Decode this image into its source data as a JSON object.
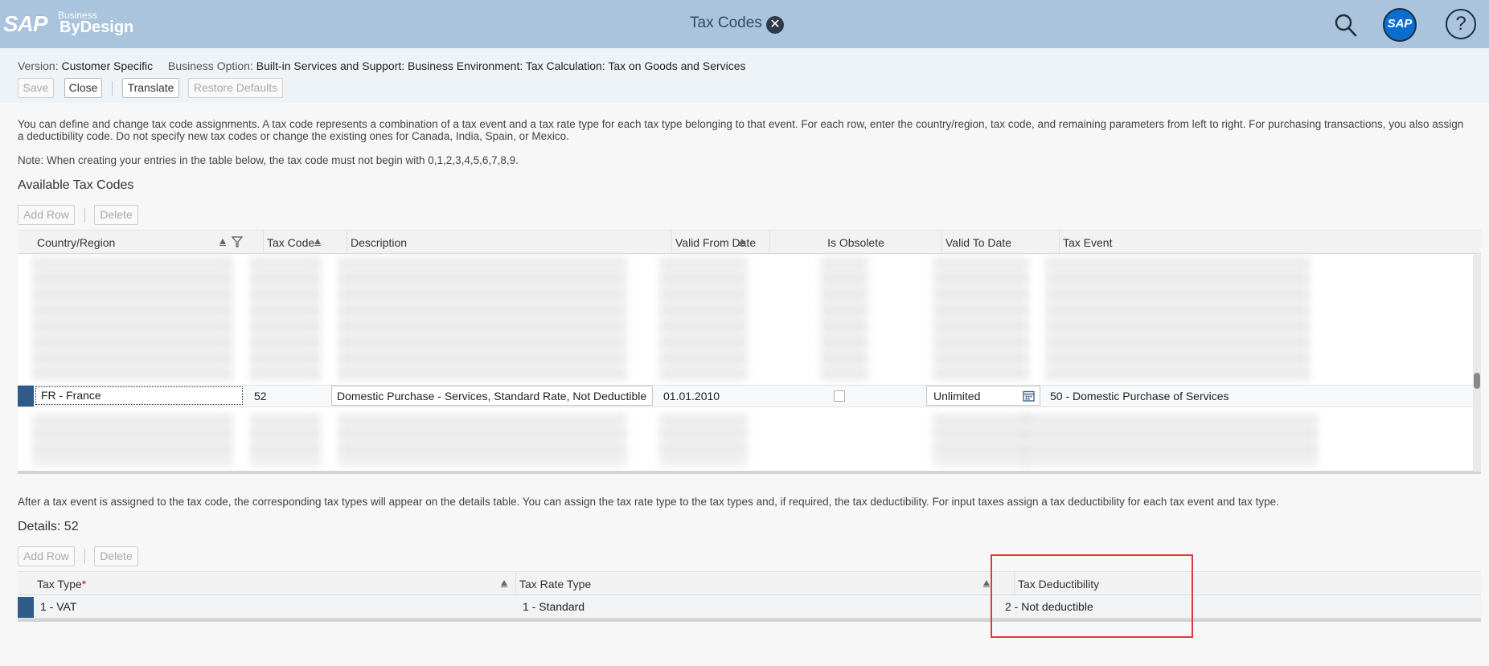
{
  "shell": {
    "logo_sap": "SAP",
    "logo_business": "Business",
    "logo_bydesign": "ByDesign",
    "title": "Tax Codes",
    "avatar_text": "SAP",
    "help_text": "?"
  },
  "header": {
    "version_label": "Version:",
    "version_value": "Customer Specific",
    "option_label": "Business Option:",
    "option_value": "Built-in Services and Support: Business Environment: Tax Calculation: Tax on Goods and Services"
  },
  "toolbar": {
    "save": "Save",
    "close": "Close",
    "translate": "Translate",
    "restore": "Restore Defaults"
  },
  "intro": {
    "paragraph": "You can define and change tax code assignments. A tax code represents a combination of a tax event and a tax rate type for each tax type belonging to that event. For each row, enter the country/region, tax code, and remaining parameters from left to right. For purchasing transactions, you also assign a deductibility code. Do not specify new tax codes or change the existing ones for Canada, India, Spain, or Mexico.",
    "note": "Note: When creating your entries in the table below, the tax code must not begin with 0,1,2,3,4,5,6,7,8,9."
  },
  "available": {
    "title": "Available Tax Codes",
    "add_row": "Add Row",
    "delete": "Delete",
    "columns": [
      "Country/Region",
      "Tax Code",
      "Description",
      "Valid From Date",
      "Is Obsolete",
      "Valid To Date",
      "Tax Event"
    ],
    "selected_row": {
      "country": "FR - France",
      "tax_code": "52",
      "description": "Domestic Purchase - Services, Standard Rate, Not Deductible",
      "valid_from": "01.01.2010",
      "is_obsolete": false,
      "valid_to": "Unlimited",
      "tax_event": "50 - Domestic Purchase of Services"
    }
  },
  "details": {
    "info": "After a tax event is assigned to the tax code, the corresponding tax types will appear on the details table. You can assign the tax rate type to the tax types and, if required, the tax deductibility. For input taxes assign a tax deductibility for each tax event and tax type.",
    "title": "Details: 52",
    "add_row": "Add Row",
    "delete": "Delete",
    "columns": [
      "Tax Type",
      "Tax Rate Type",
      "Tax Deductibility"
    ],
    "required_marker": "*",
    "row": {
      "tax_type": "1 - VAT",
      "tax_rate_type": "1 - Standard",
      "tax_deductibility": "2 - Not deductible"
    }
  },
  "colors": {
    "shell": "#a9c4dc",
    "selection": "#2e5b87",
    "highlight": "#e0393e"
  }
}
